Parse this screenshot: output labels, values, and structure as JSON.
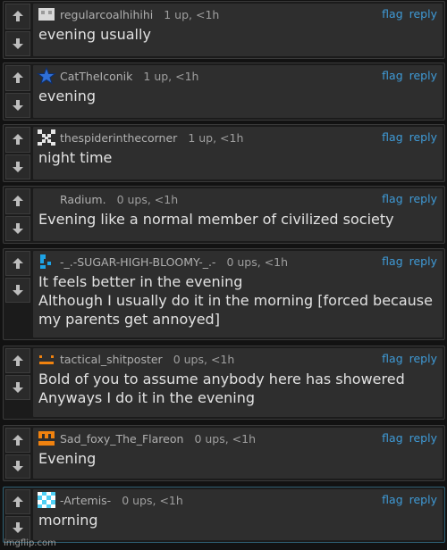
{
  "actions": {
    "flag": "flag",
    "reply": "reply"
  },
  "colors": {
    "link": "#3f9ad6",
    "panel": "#2e2e2e",
    "background": "#121212"
  },
  "comments": [
    {
      "username": "regularcoalhihihi",
      "score": "1 up, <1h",
      "text": "evening usually",
      "avatar": "gray-pixel-icon"
    },
    {
      "username": "CatTheIconik",
      "score": "1 up, <1h",
      "text": "evening",
      "avatar": "blue-star-icon"
    },
    {
      "username": "thespiderinthecorner",
      "score": "1 up, <1h",
      "text": "night time",
      "avatar": "white-x-pixel-icon"
    },
    {
      "username": "Radium.",
      "score": "0 ups, <1h",
      "text": "Evening like a normal member of civilized society",
      "avatar": "blank-avatar"
    },
    {
      "username": "-_.-SUGAR-HIGH-BLOOMY-_.-",
      "score": "0 ups, <1h",
      "text": "It feels better in the evening\nAlthough I usually do it in the morning [forced because my parents get annoyed]",
      "avatar": "blue-pixel-icon"
    },
    {
      "username": "tactical_shitposter",
      "score": "0 ups, <1h",
      "text": "Bold of you to assume anybody here has showered\nAnyways I do it in the evening",
      "avatar": "orange-dash-face-icon"
    },
    {
      "username": "Sad_foxy_The_Flareon",
      "score": "0 ups, <1h",
      "text": "Evening",
      "avatar": "orange-pixel-face-icon"
    },
    {
      "username": "-Artemis-",
      "score": "0 ups, <1h",
      "text": "morning",
      "avatar": "cyan-checker-icon"
    }
  ],
  "watermark": "imgflip.com"
}
